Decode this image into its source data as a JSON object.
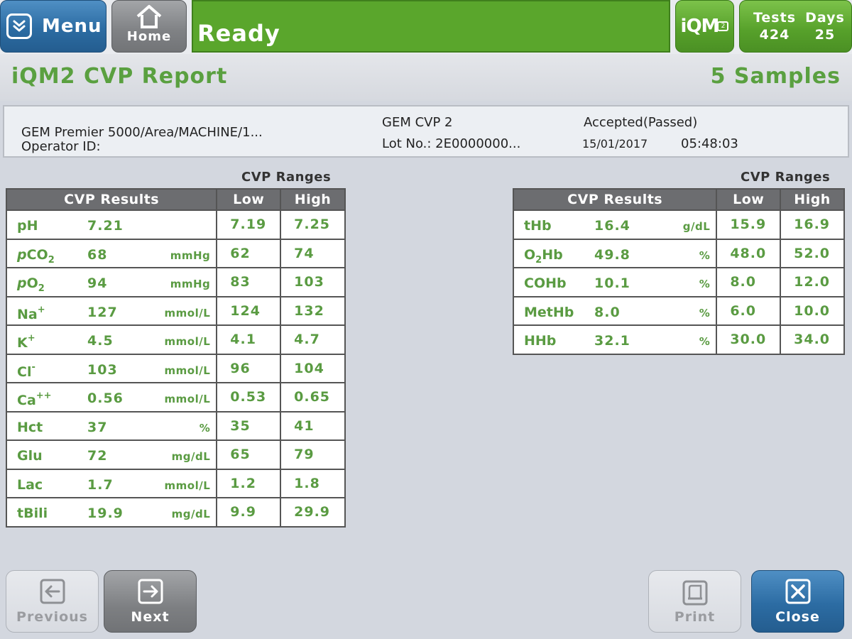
{
  "topbar": {
    "menu_label": "Menu",
    "home_label": "Home",
    "status": "Ready",
    "iqm_label": "iQM",
    "iqm_badge": "2",
    "tests_label": "Tests",
    "tests_value": "424",
    "days_label": "Days",
    "days_value": "25"
  },
  "header": {
    "title": "iQM2 CVP Report",
    "samples": "5 Samples"
  },
  "info": {
    "instrument": "GEM Premier 5000/Area/MACHINE/1...",
    "operator": "Operator ID:",
    "cvp": "GEM CVP 2",
    "lot": "Lot No.: 2E0000000...",
    "status": "Accepted(Passed)",
    "date": "15/01/2017",
    "time": "05:48:03"
  },
  "left_table": {
    "ranges_label": "CVP Ranges",
    "headers": [
      "CVP Results",
      "Low",
      "High"
    ],
    "rows": [
      {
        "name": "pH",
        "value": "7.21",
        "unit": "",
        "low": "7.19",
        "high": "7.25"
      },
      {
        "name": "pCO2",
        "value": "68",
        "unit": "mmHg",
        "low": "62",
        "high": "74"
      },
      {
        "name": "pO2",
        "value": "94",
        "unit": "mmHg",
        "low": "83",
        "high": "103"
      },
      {
        "name": "Na+",
        "value": "127",
        "unit": "mmol/L",
        "low": "124",
        "high": "132"
      },
      {
        "name": "K+",
        "value": "4.5",
        "unit": "mmol/L",
        "low": "4.1",
        "high": "4.7"
      },
      {
        "name": "Cl-",
        "value": "103",
        "unit": "mmol/L",
        "low": "96",
        "high": "104"
      },
      {
        "name": "Ca++",
        "value": "0.56",
        "unit": "mmol/L",
        "low": "0.53",
        "high": "0.65"
      },
      {
        "name": "Hct",
        "value": "37",
        "unit": "%",
        "low": "35",
        "high": "41"
      },
      {
        "name": "Glu",
        "value": "72",
        "unit": "mg/dL",
        "low": "65",
        "high": "79"
      },
      {
        "name": "Lac",
        "value": "1.7",
        "unit": "mmol/L",
        "low": "1.2",
        "high": "1.8"
      },
      {
        "name": "tBili",
        "value": "19.9",
        "unit": "mg/dL",
        "low": "9.9",
        "high": "29.9"
      }
    ]
  },
  "right_table": {
    "ranges_label": "CVP Ranges",
    "headers": [
      "CVP Results",
      "Low",
      "High"
    ],
    "rows": [
      {
        "name": "tHb",
        "value": "16.4",
        "unit": "g/dL",
        "low": "15.9",
        "high": "16.9"
      },
      {
        "name": "O2Hb",
        "value": "49.8",
        "unit": "%",
        "low": "48.0",
        "high": "52.0"
      },
      {
        "name": "COHb",
        "value": "10.1",
        "unit": "%",
        "low": "8.0",
        "high": "12.0"
      },
      {
        "name": "MetHb",
        "value": "8.0",
        "unit": "%",
        "low": "6.0",
        "high": "10.0"
      },
      {
        "name": "HHb",
        "value": "32.1",
        "unit": "%",
        "low": "30.0",
        "high": "34.0"
      }
    ]
  },
  "footer": {
    "previous_label": "Previous",
    "next_label": "Next",
    "print_label": "Print",
    "close_label": "Close"
  }
}
